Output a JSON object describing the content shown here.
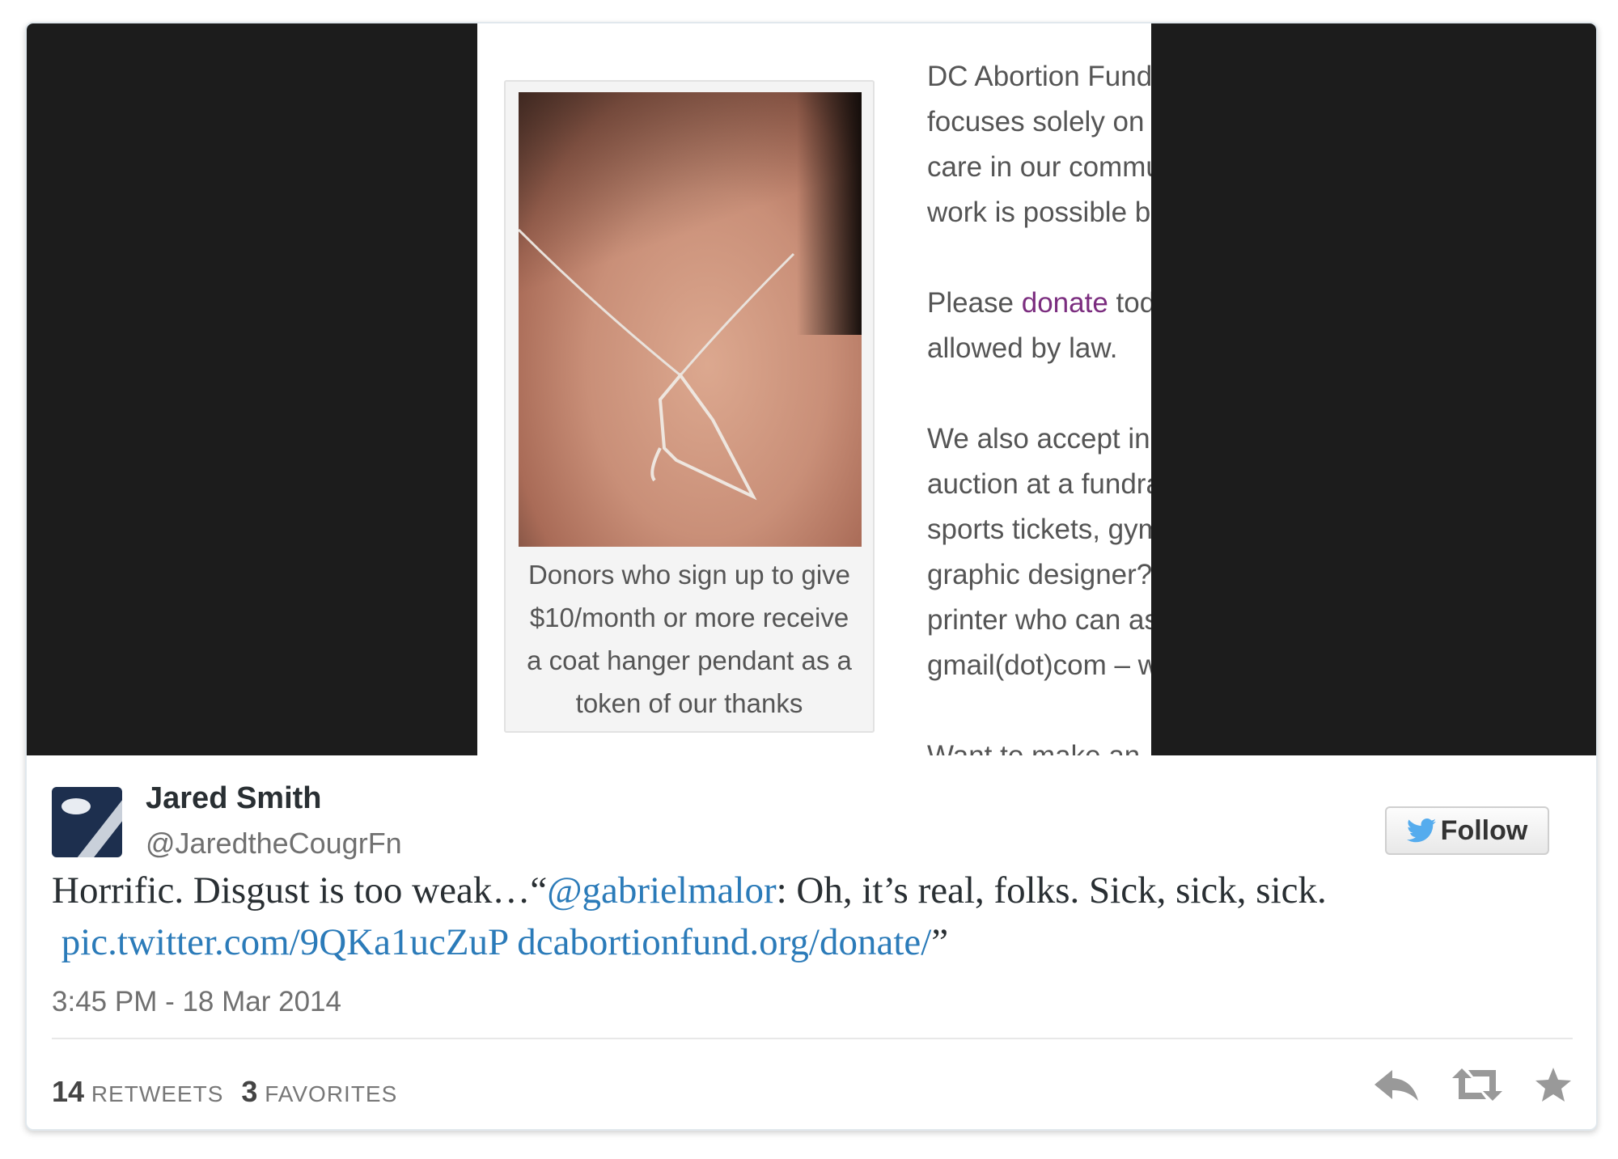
{
  "media": {
    "caption": [
      "Donors who sign up to give",
      "$10/month or more receive",
      "a coat hanger pendant as a",
      "token of our thanks"
    ],
    "article": {
      "p1": [
        "DC Abortion Fund",
        "focuses solely on c",
        "care in our commu",
        "work is possible be"
      ],
      "p2_prefix": "Please ",
      "p2_link": "donate",
      "p2_suffix": " toda",
      "p2_line2": "allowed by law.",
      "p3": [
        "We also accept in-",
        "auction at a fundra",
        "sports tickets, gym",
        "graphic designer?",
        "printer who can as",
        "gmail(dot)com – w"
      ],
      "p4": "Want to make an"
    }
  },
  "tweet": {
    "author": {
      "name": "Jared Smith",
      "handle": "@JaredtheCougrFn"
    },
    "follow_label": "Follow",
    "text": {
      "part1": "Horrific. Disgust is too weak…“",
      "mention": "@gabrielmalor",
      "part2": ": Oh, it’s real, folks. Sick, sick, sick.",
      "link1": "pic.twitter.com/9QKa1ucZuP",
      "link2": "dcabortionfund.org/donate/",
      "close_quote": "”"
    },
    "timestamp": "3:45 PM - 18 Mar 2014",
    "stats": {
      "retweets_count": "14",
      "retweets_label": "RETWEETS",
      "favorites_count": "3",
      "favorites_label": "FAVORITES"
    },
    "icons": {
      "follow": "twitter-bird-icon",
      "reply": "reply-icon",
      "retweet": "retweet-icon",
      "favorite": "star-icon"
    },
    "colors": {
      "link": "#2b7bb9",
      "twitter_blue": "#55acee",
      "media_background": "#1c1c1c"
    }
  }
}
